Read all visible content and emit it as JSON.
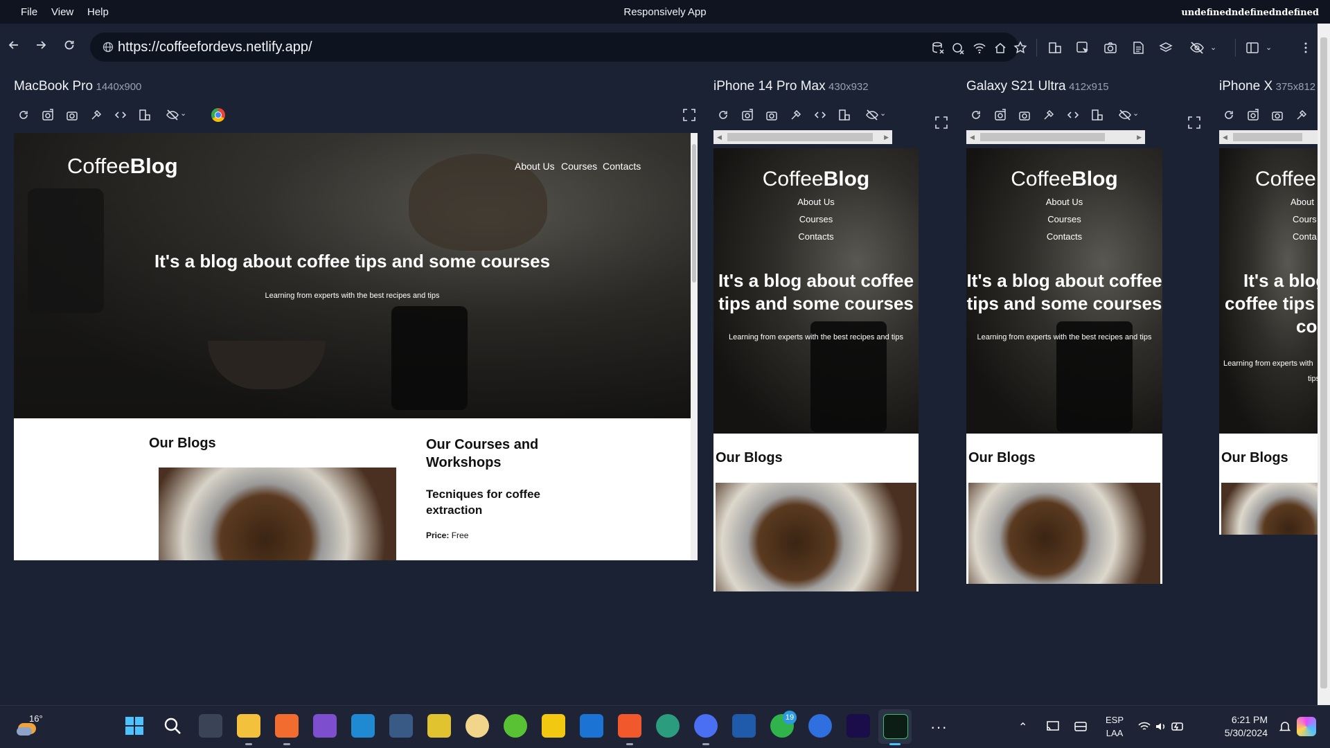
{
  "menubar": {
    "items": [
      "File",
      "View",
      "Help"
    ],
    "app_title": "Responsively App",
    "window_title_right": "undefinedndefinedndefined"
  },
  "navbar": {
    "url": "https://coffeefordevs.netlify.app/",
    "toolbar_icons": [
      "clear-storage-icon",
      "clear-cache-icon",
      "network-icon",
      "home-icon",
      "bookmark-star-icon",
      "devtools-layout-icon",
      "inspect-icon",
      "screenshot-icon",
      "document-icon",
      "layers-icon",
      "hide-icon",
      "layout-icon",
      "more-icon"
    ]
  },
  "site": {
    "logo_light": "Coffee",
    "logo_bold": "Blog",
    "nav": [
      "About Us",
      "Courses",
      "Contacts"
    ],
    "hero_title": "It's a blog about coffee tips and some courses",
    "hero_title_wrapped_1": "It's a blog about coffee",
    "hero_title_wrapped_2": "tips and some courses",
    "hero_subtitle": "Learning from experts with the best recipes and tips",
    "blogs_title": "Our Blogs",
    "courses_title_1": "Our Courses and",
    "courses_title_2": "Workshops",
    "course_name_1": "Tecniques for coffee",
    "course_name_2": "extraction",
    "price_label": "Price:",
    "price_value": "Free"
  },
  "devices": [
    {
      "name": "MacBook Pro",
      "size": "1440x900"
    },
    {
      "name": "iPhone 14 Pro Max",
      "size": "430x932"
    },
    {
      "name": "Galaxy S21 Ultra",
      "size": "412x915"
    },
    {
      "name": "iPhone X",
      "size": "375x812"
    }
  ],
  "truncated": {
    "logo": "Coffee",
    "nav": [
      "About",
      "Cours",
      "Conta"
    ],
    "title_1": "It's a blog",
    "title_2": "coffee tips a",
    "title_3": "cours",
    "sub_1": "Learning from experts with",
    "sub_2": "tips"
  },
  "taskbar": {
    "weather_temp": "16°",
    "whatsapp_badge": "19",
    "lang_1": "ESP",
    "lang_2": "LAA",
    "time": "6:21 PM",
    "date": "5/30/2024"
  },
  "colors": {
    "app_bg": "#1b2233",
    "menubar_bg": "#0f1420",
    "urlbar_bg": "#0e1320"
  }
}
